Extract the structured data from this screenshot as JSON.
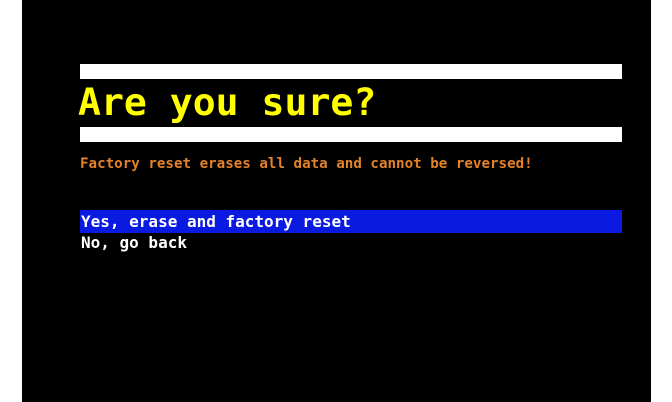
{
  "dialog": {
    "title": "Are you sure?",
    "message": "Factory reset erases all data and cannot be reversed!",
    "options": [
      {
        "label": "Yes, erase and factory reset",
        "selected": true
      },
      {
        "label": "No, go back",
        "selected": false
      }
    ]
  },
  "colors": {
    "background": "#000000",
    "frame": "#ffffff",
    "title": "#ffff00",
    "message": "#e3822a",
    "selection": "#0b1ae0",
    "option_text": "#ffffff"
  }
}
